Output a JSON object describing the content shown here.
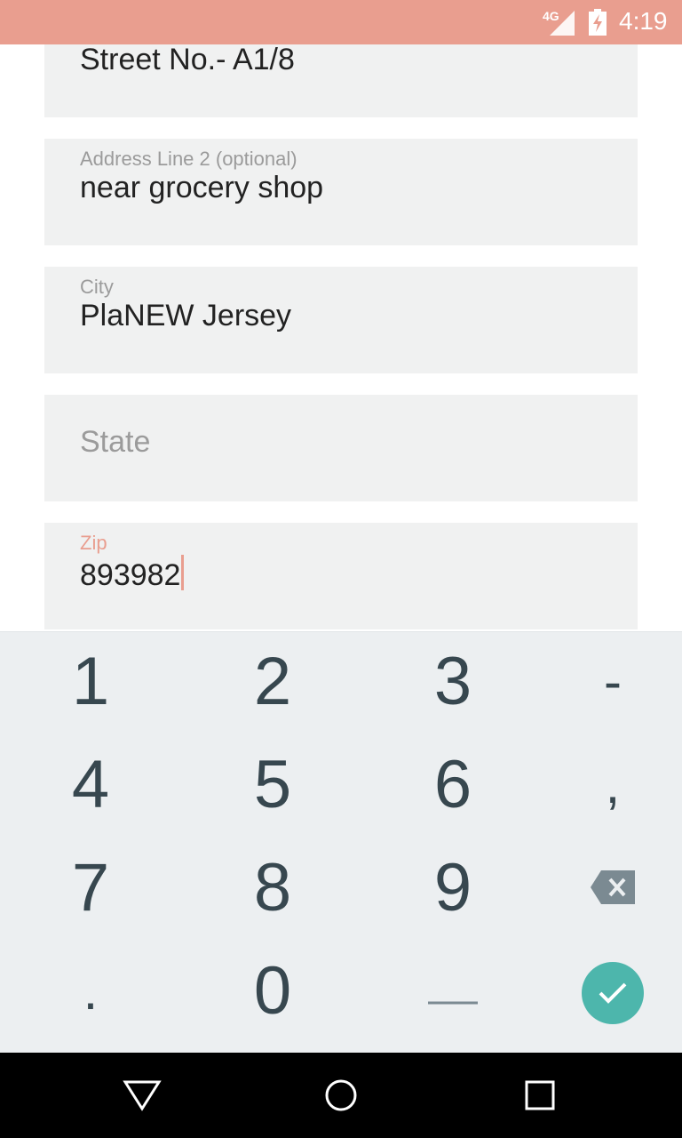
{
  "status_bar": {
    "network": "4G",
    "time": "4:19",
    "color": "#e99e8f"
  },
  "form": {
    "fields": [
      {
        "label": "",
        "value": "Street No.- A1/8"
      },
      {
        "label": "Address Line 2 (optional)",
        "value": "near grocery shop"
      },
      {
        "label": "City",
        "value": "PlaNEW Jersey"
      },
      {
        "label": "State",
        "value": "",
        "placeholder": "State"
      },
      {
        "label": "Zip",
        "value": "893982"
      }
    ],
    "accent_color": "#e99e8f"
  },
  "keyboard": {
    "keys": [
      "1",
      "2",
      "3",
      "-",
      "4",
      "5",
      "6",
      ",",
      "7",
      "8",
      "9",
      "backspace",
      ".",
      "0",
      "_",
      "done"
    ],
    "done_color": "#4db6ac",
    "text_color": "#37474f"
  },
  "nav_bar": {
    "icons": [
      "back-icon",
      "home-icon",
      "recents-icon"
    ]
  }
}
